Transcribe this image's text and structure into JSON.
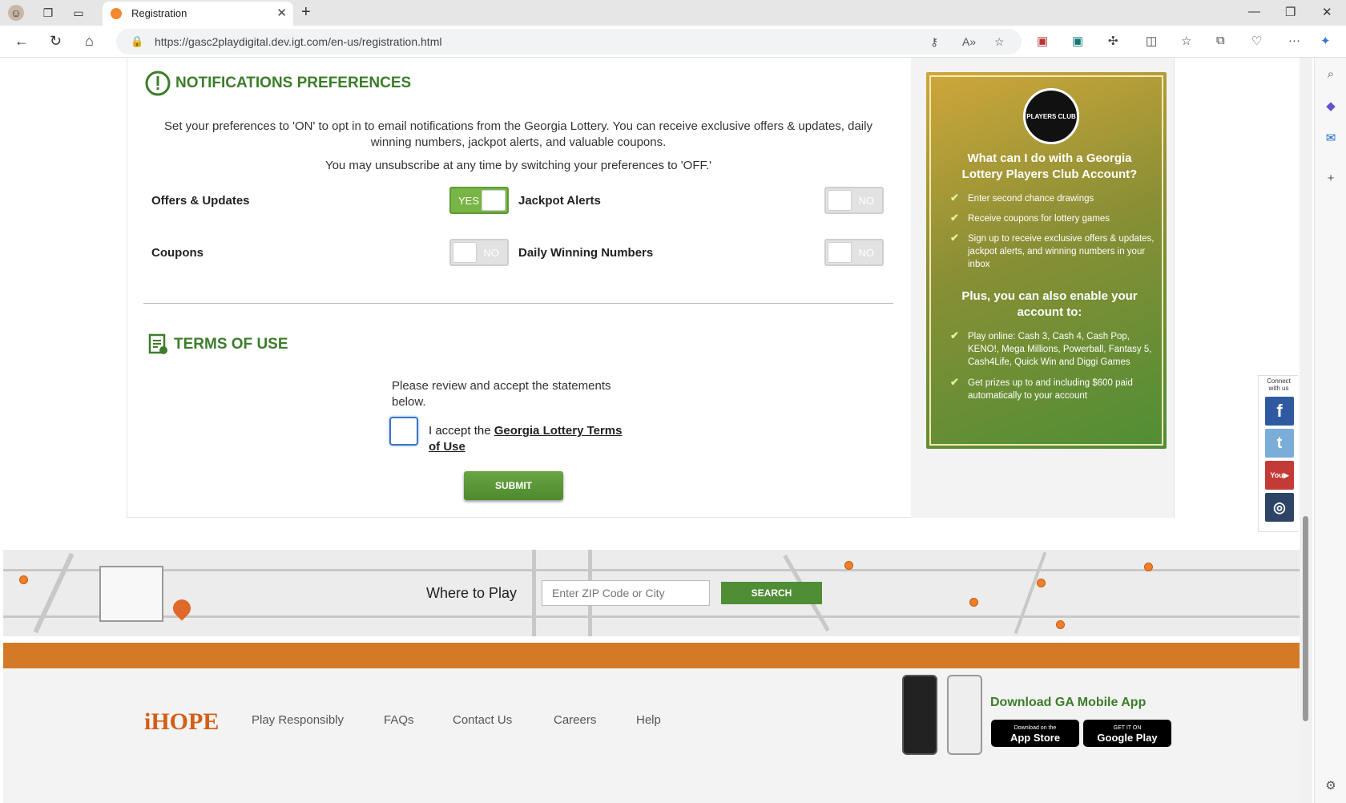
{
  "browser": {
    "tab_title": "Registration",
    "url": "https://gasc2playdigital.dev.igt.com/en-us/registration.html"
  },
  "notifications": {
    "heading": "NOTIFICATIONS PREFERENCES",
    "intro": "Set your preferences to 'ON' to opt in to email notifications from the Georgia Lottery. You can receive exclusive offers & updates, daily winning numbers, jackpot alerts, and valuable coupons.",
    "unsubscribe": "You may unsubscribe at any time by switching your preferences to 'OFF.'",
    "prefs": [
      {
        "label": "Offers & Updates",
        "state": "YES"
      },
      {
        "label": "Jackpot Alerts",
        "state": "NO"
      },
      {
        "label": "Coupons",
        "state": "NO"
      },
      {
        "label": "Daily Winning Numbers",
        "state": "NO"
      }
    ]
  },
  "terms": {
    "heading": "TERMS OF USE",
    "review": "Please review and accept the statements below.",
    "accept_prefix": "I accept the ",
    "accept_link": "Georgia Lottery Terms of Use",
    "submit": "SUBMIT"
  },
  "promo": {
    "logo_text": "PLAYERS CLUB",
    "heading": "What can I do with a Georgia Lottery Players Club Account?",
    "items": [
      "Enter second chance drawings",
      "Receive coupons for lottery games",
      "Sign up to receive exclusive offers & updates, jackpot alerts, and winning numbers in your inbox"
    ],
    "subheading": "Plus, you can also enable your account to:",
    "items2": [
      "Play online: Cash 3, Cash 4, Cash Pop, KENO!, Mega Millions, Powerball, Fantasy 5, Cash4Life, Quick Win and Diggi Games",
      "Get prizes up to and including $600 paid automatically to your account"
    ]
  },
  "connect": {
    "label": "Connect with us",
    "icons": [
      "facebook-icon",
      "twitter-icon",
      "youtube-icon",
      "instagram-icon"
    ]
  },
  "where_to_play": {
    "label": "Where to Play",
    "placeholder": "Enter ZIP Code or City",
    "button": "SEARCH"
  },
  "footer": {
    "logo": "iHOPE",
    "links": [
      "Play Responsibly",
      "FAQs",
      "Contact Us",
      "Careers",
      "Help"
    ],
    "app_heading": "Download GA Mobile App",
    "app_store": "App Store",
    "app_store_small": "Download on the",
    "google_play": "Google Play",
    "google_play_small": "GET IT ON"
  },
  "colors": {
    "accent_green": "#3c7d2a",
    "orange_band": "#d47a27",
    "toggle_on": "#79b446"
  }
}
